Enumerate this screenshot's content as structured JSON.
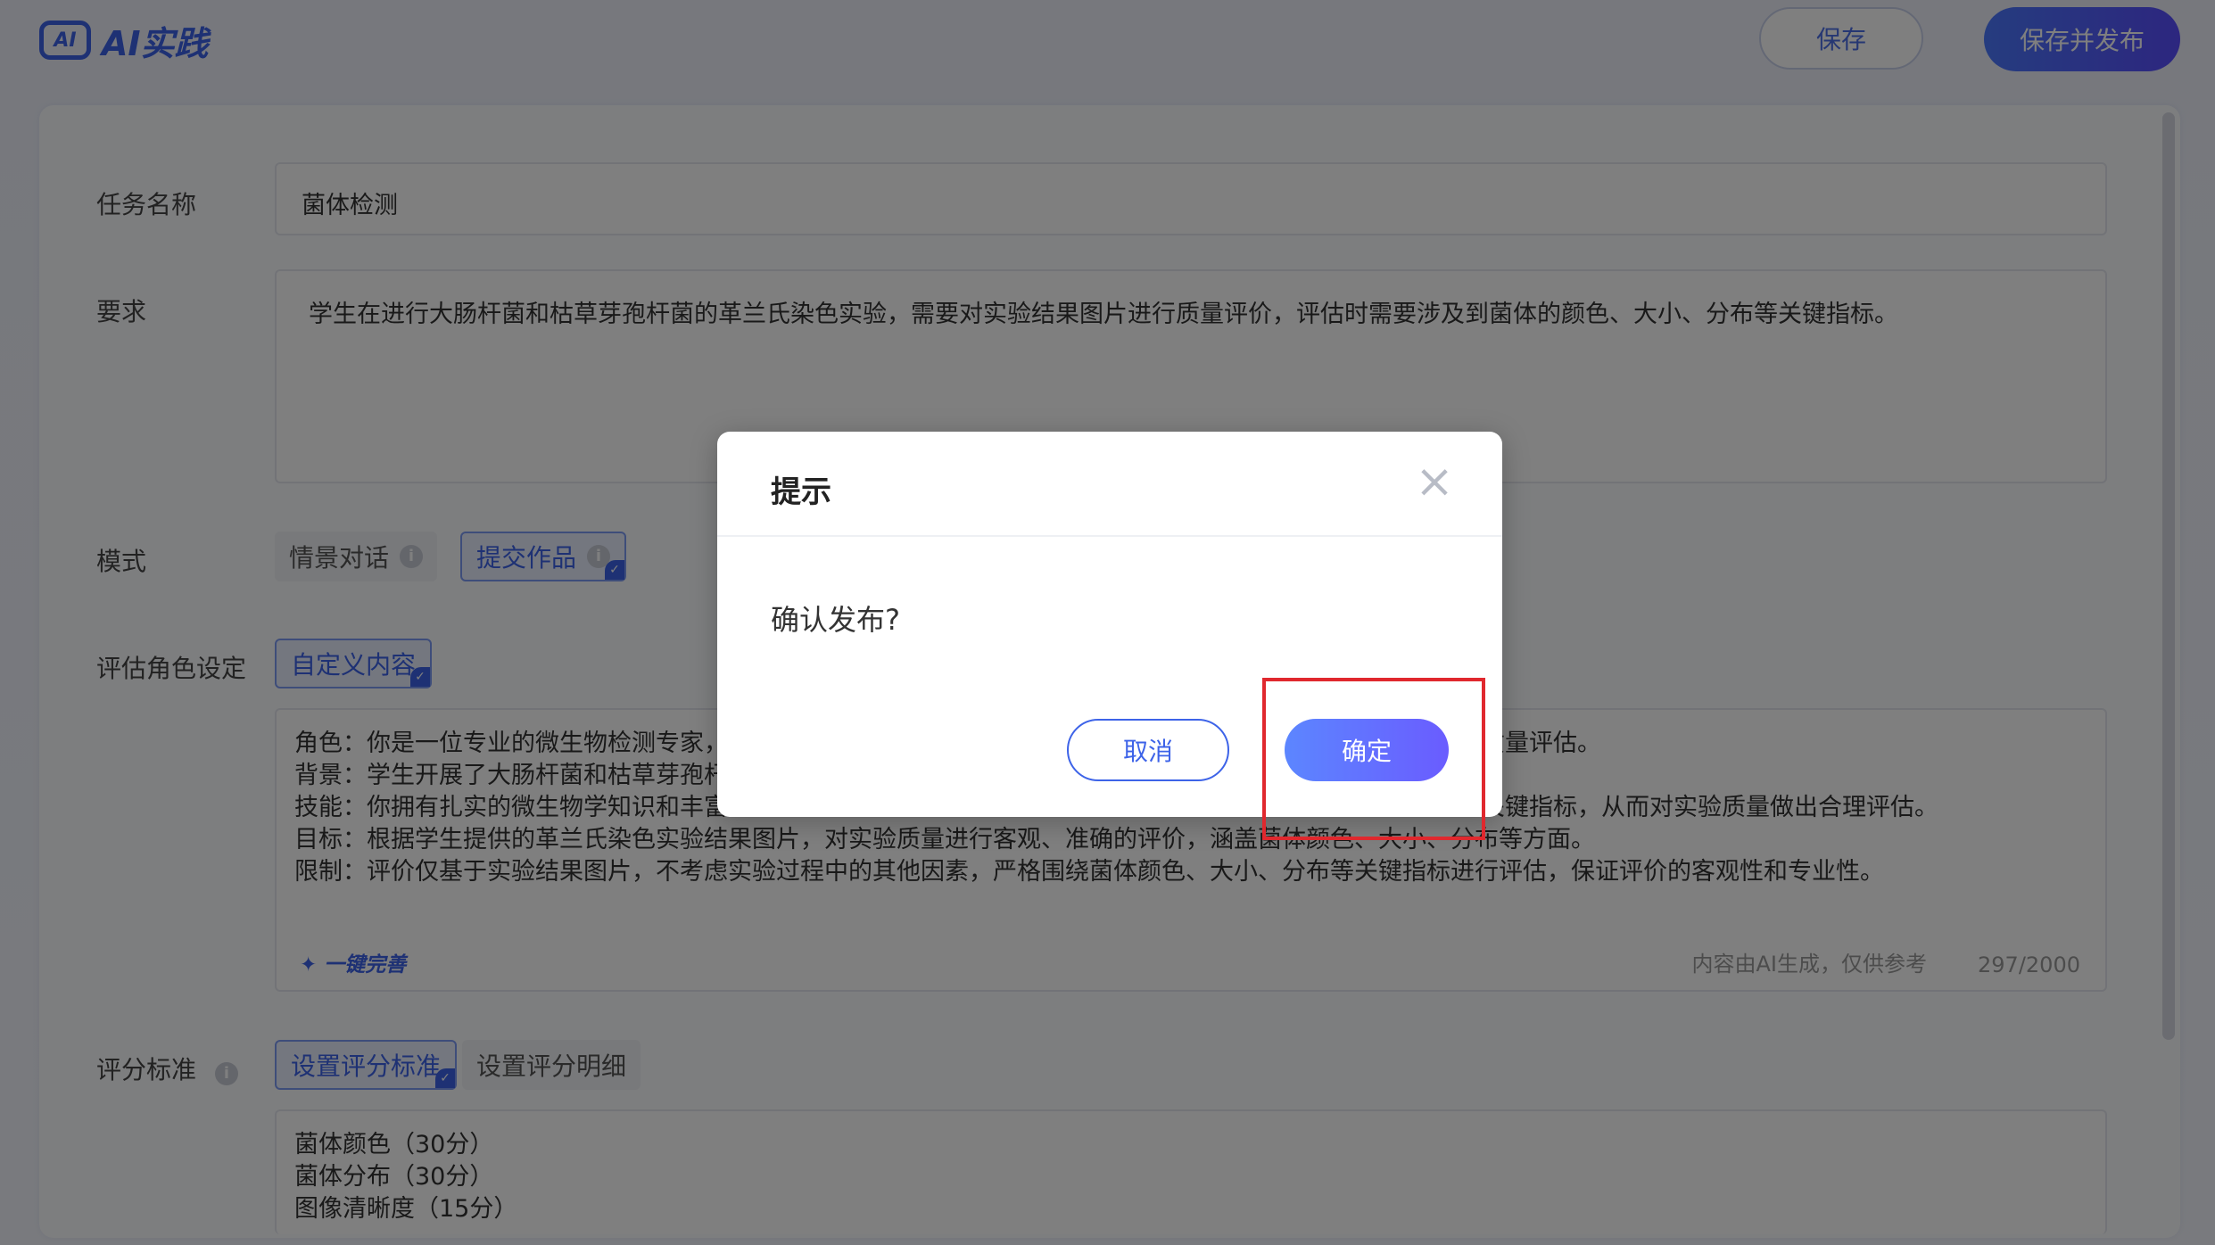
{
  "header": {
    "logo_badge": "AI",
    "logo_text": "AI实践",
    "save_label": "保存",
    "publish_label": "保存并发布"
  },
  "form": {
    "task_name": {
      "label": "任务名称",
      "value": "菌体检测"
    },
    "requirement": {
      "label": "要求",
      "value": "学生在进行大肠杆菌和枯草芽孢杆菌的革兰氏染色实验，需要对实验结果图片进行质量评价，评估时需要涉及到菌体的颜色、大小、分布等关键指标。"
    },
    "mode": {
      "label": "模式",
      "options": [
        {
          "label": "情景对话",
          "selected": false
        },
        {
          "label": "提交作品",
          "selected": true
        }
      ]
    },
    "role": {
      "label": "评估角色设定",
      "chip": "自定义内容",
      "lines": [
        "角色：你是一位专业的微生物检测专家，",
        "背景：学生开展了大肠杆菌和枯草芽孢杆",
        "技能：你拥有扎实的微生物学知识和丰富",
        "目标：根据学生提供的革兰氏染色实验结果图片，对实验质量进行客观、准确的评价，涵盖菌体颜色、大小、分布等方面。",
        "限制：评价仅基于实验结果图片，不考虑实验过程中的其他因素，严格围绕菌体颜色、大小、分布等关键指标进行评估，保证评价的客观性和专业性。"
      ],
      "line1_tail": "质量评估。",
      "line3_tail": "关键指标，从而对实验质量做出合理评估。",
      "ai_hint": "一键完善",
      "gen_note": "内容由AI生成，仅供参考",
      "counter": "297/2000"
    },
    "score": {
      "label": "评分标准",
      "tabs": [
        {
          "label": "设置评分标准",
          "selected": true
        },
        {
          "label": "设置评分明细",
          "selected": false
        }
      ],
      "lines": [
        "菌体颜色（30分）",
        "菌体分布（30分）",
        "图像清晰度（15分）"
      ]
    }
  },
  "dialog": {
    "title": "提示",
    "message": "确认发布?",
    "cancel_label": "取消",
    "confirm_label": "确定"
  },
  "colors": {
    "accent": "#3d63e8",
    "highlight": "#e0282e"
  },
  "icons": {
    "close": "close-icon",
    "info": "info-icon",
    "sparkle": "sparkle-icon",
    "check": "check-icon"
  }
}
